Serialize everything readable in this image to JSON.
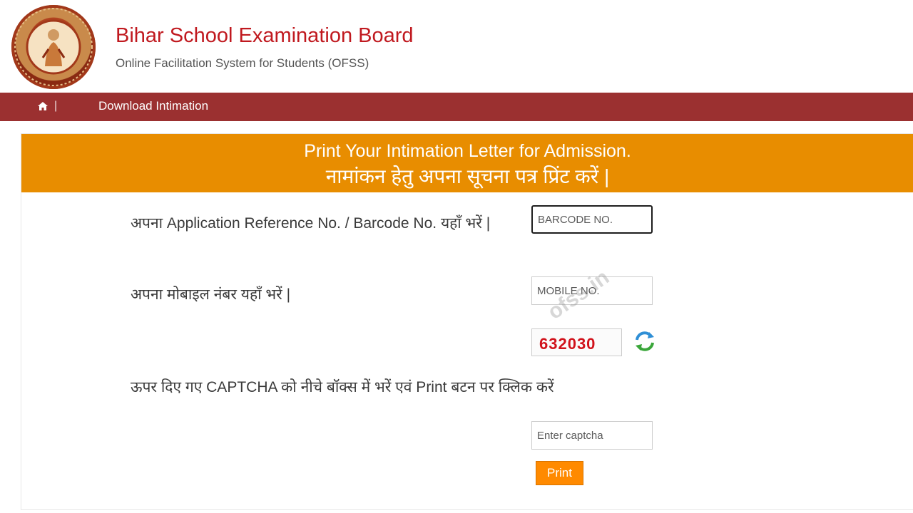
{
  "header": {
    "title": "Bihar School Examination Board",
    "subtitle": "Online Facilitation System for Students (OFSS)",
    "logo": "bseb-emblem-logo"
  },
  "nav": {
    "home_icon": "home-icon",
    "home_separator": "|",
    "items": [
      {
        "label": "Download Intimation"
      }
    ]
  },
  "panel": {
    "heading_en": "Print Your Intimation Letter for Admission.",
    "heading_hi": "नामांकन हेतु अपना सूचना पत्र प्रिंट करें |"
  },
  "form": {
    "barcode_label": "अपना Application Reference No. / Barcode No. यहाँ भरें |",
    "barcode_placeholder": "BARCODE NO.",
    "mobile_label": "अपना मोबाइल नंबर यहाँ भरें |",
    "mobile_placeholder": "MOBILE NO.",
    "captcha_value": "632030",
    "refresh_icon": "refresh-icon",
    "captcha_instruction": "ऊपर दिए गए CAPTCHA को नीचे बॉक्स में भरें एवं Print बटन पर क्लिक करें",
    "captcha_placeholder": "Enter captcha",
    "print_label": "Print"
  },
  "watermark": "ofss.in",
  "colors": {
    "title_red": "#c0191f",
    "nav_bg": "#9b3030",
    "panel_head_bg": "#e88d00",
    "print_btn": "#ff8a00",
    "captcha_red": "#d1121b"
  }
}
